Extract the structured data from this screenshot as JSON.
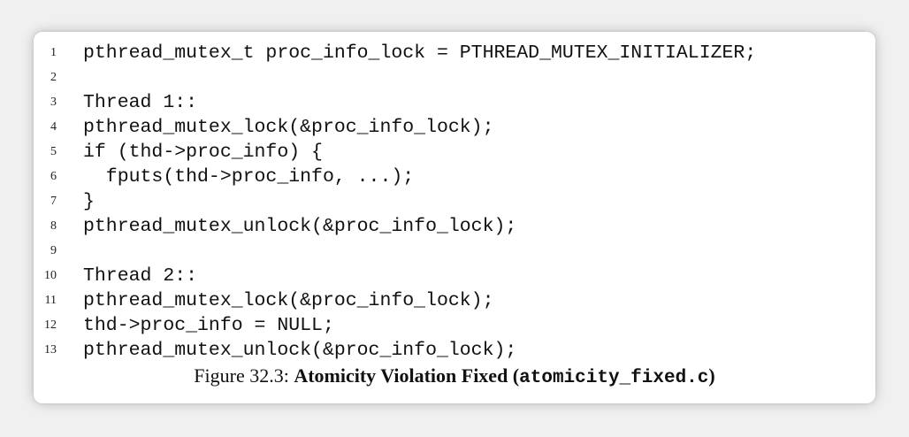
{
  "code": {
    "lines": [
      {
        "n": "1",
        "text": "pthread_mutex_t proc_info_lock = PTHREAD_MUTEX_INITIALIZER;"
      },
      {
        "n": "2",
        "text": ""
      },
      {
        "n": "3",
        "text": "Thread 1::"
      },
      {
        "n": "4",
        "text": "pthread_mutex_lock(&proc_info_lock);"
      },
      {
        "n": "5",
        "text": "if (thd->proc_info) {"
      },
      {
        "n": "6",
        "text": "  fputs(thd->proc_info, ...);"
      },
      {
        "n": "7",
        "text": "}"
      },
      {
        "n": "8",
        "text": "pthread_mutex_unlock(&proc_info_lock);"
      },
      {
        "n": "9",
        "text": ""
      },
      {
        "n": "10",
        "text": "Thread 2::"
      },
      {
        "n": "11",
        "text": "pthread_mutex_lock(&proc_info_lock);"
      },
      {
        "n": "12",
        "text": "thd->proc_info = NULL;"
      },
      {
        "n": "13",
        "text": "pthread_mutex_unlock(&proc_info_lock);"
      }
    ]
  },
  "caption": {
    "label": "Figure 32.3: ",
    "title": "Atomicity Violation Fixed (",
    "filename": "atomicity_fixed.c",
    "close": ")"
  }
}
